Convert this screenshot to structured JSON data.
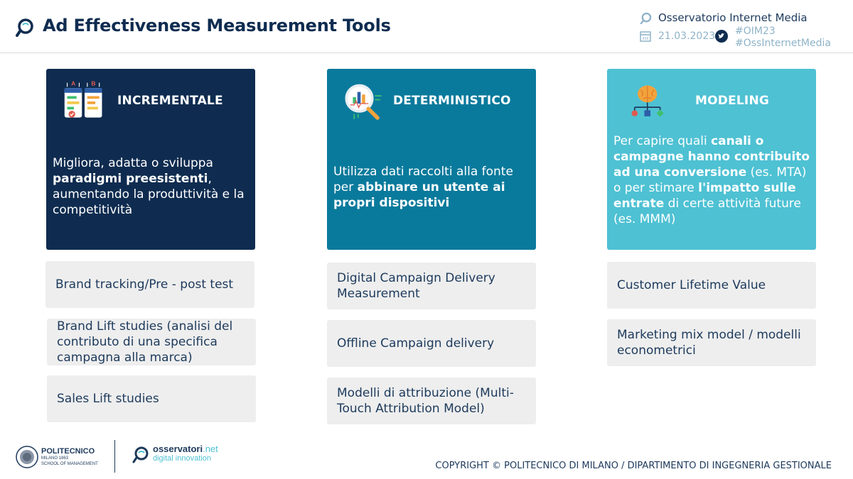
{
  "header": {
    "title": "Ad Effectiveness Measurement Tools",
    "org": "Osservatorio Internet Media",
    "date": "21.03.2023",
    "hashtag1": "#OIM23",
    "hashtag2": "#OssInternetMedia"
  },
  "columns": [
    {
      "title": "INCREMENTALE",
      "icon": "ab-test-icon",
      "color": "#0f2c50",
      "desc_parts": [
        "Migliora, adatta o sviluppa ",
        "paradigmi preesistenti",
        ", aumentando la produttività e la competitività"
      ],
      "tools": [
        "Brand tracking/Pre - post test",
        "Brand Lift studies (analisi  del contributo di una specifica campagna alla marca)",
        "Sales Lift studies"
      ]
    },
    {
      "title": "DETERMINISTICO",
      "icon": "magnifier-chart-icon",
      "color": "#0a7a9c",
      "desc_parts": [
        "Utilizza dati raccolti alla fonte per ",
        "abbinare un utente ai propri dispositivi",
        ""
      ],
      "tools": [
        "Digital Campaign Delivery Measurement",
        "Offline Campaign delivery",
        "Modelli di attribuzione (Multi-Touch Attribution Model)"
      ]
    },
    {
      "title": "MODELING",
      "icon": "brain-network-icon",
      "color": "#4ec1d3",
      "desc_parts": [
        "Per capire quali ",
        "canali o campagne hanno contribuito ad una conversione",
        " (es. MTA) o per stimare ",
        "l'impatto sulle entrate",
        " di certe attività future (es. MMM)"
      ],
      "tools": [
        "Customer Lifetime Value",
        "Marketing mix model / modelli econometrici"
      ]
    }
  ],
  "footer": {
    "poli_name": "POLITECNICO",
    "poli_sub1": "MILANO 1863",
    "poli_sub2": "SCHOOL OF MANAGEMENT",
    "oss_name": "osservatori",
    "oss_net": ".net",
    "oss_tag": "digital innovation",
    "copyright": "COPYRIGHT © POLITECNICO DI MILANO / DIPARTIMENTO DI INGEGNERIA GESTIONALE"
  }
}
